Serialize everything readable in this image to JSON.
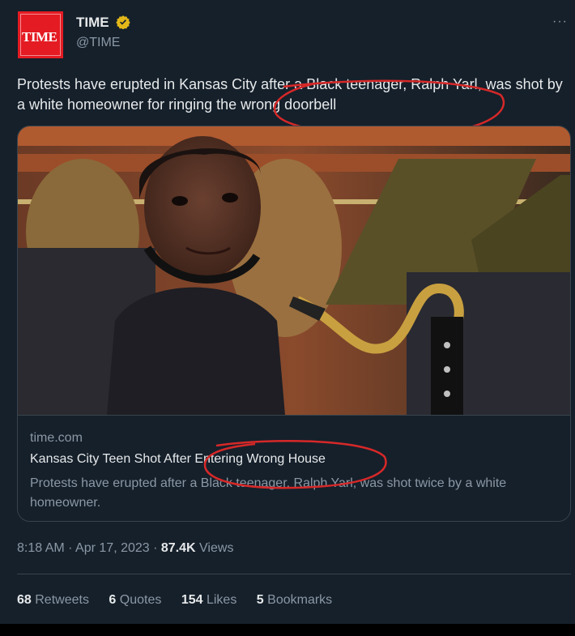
{
  "author": {
    "name": "TIME",
    "handle": "@TIME",
    "avatar_text": "TIME",
    "verified_color": "#e2b719"
  },
  "tweet": {
    "text": "Protests have erupted in Kansas City after a Black teenager, Ralph Yarl, was shot by a white homeowner for ringing the wrong doorbell"
  },
  "card": {
    "image_alt": "teen-with-clarinet-photo",
    "domain": "time.com",
    "title": "Kansas City Teen Shot After Entering Wrong House",
    "description": "Protests have erupted after a Black teenager, Ralph Yarl, was shot twice by a white homeowner."
  },
  "meta": {
    "time": "8:18 AM",
    "date": "Apr 17, 2023",
    "views_count": "87.4K",
    "views_label": "Views"
  },
  "stats": {
    "retweets_count": "68",
    "retweets_label": "Retweets",
    "quotes_count": "6",
    "quotes_label": "Quotes",
    "likes_count": "154",
    "likes_label": "Likes",
    "bookmarks_count": "5",
    "bookmarks_label": "Bookmarks"
  },
  "colors": {
    "background": "#15202b",
    "annotation": "#d62828"
  }
}
